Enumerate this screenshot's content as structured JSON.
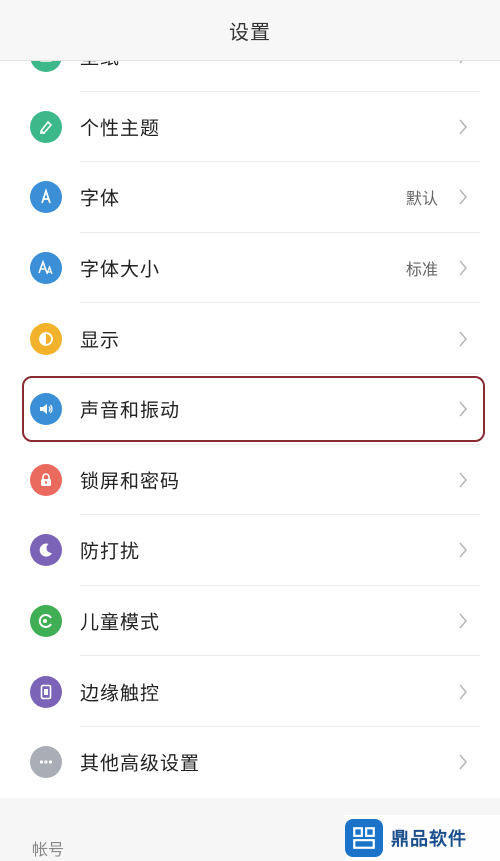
{
  "header": {
    "title": "设置"
  },
  "items": [
    {
      "label": "壁纸",
      "value": "",
      "icon": "wallpaper-icon",
      "color": "#3db88a"
    },
    {
      "label": "个性主题",
      "value": "",
      "icon": "theme-brush-icon",
      "color": "#3db88a"
    },
    {
      "label": "字体",
      "value": "默认",
      "icon": "font-a-icon",
      "color": "#3b8fd6"
    },
    {
      "label": "字体大小",
      "value": "标准",
      "icon": "font-size-icon",
      "color": "#3b8fd6"
    },
    {
      "label": "显示",
      "value": "",
      "icon": "display-brightness-icon",
      "color": "#f2b22c"
    },
    {
      "label": "声音和振动",
      "value": "",
      "icon": "speaker-icon",
      "color": "#3b8fd6"
    },
    {
      "label": "锁屏和密码",
      "value": "",
      "icon": "lock-icon",
      "color": "#ea6a5e"
    },
    {
      "label": "防打扰",
      "value": "",
      "icon": "moon-icon",
      "color": "#7b64b8"
    },
    {
      "label": "儿童模式",
      "value": "",
      "icon": "kids-mode-icon",
      "color": "#3fae54"
    },
    {
      "label": "边缘触控",
      "value": "",
      "icon": "edge-touch-icon",
      "color": "#7b64b8"
    },
    {
      "label": "其他高级设置",
      "value": "",
      "icon": "more-settings-icon",
      "color": "#a9aeb6"
    }
  ],
  "section_label": "帐号",
  "watermark": {
    "text": "鼎品软件",
    "icon": "brand-logo-icon"
  }
}
